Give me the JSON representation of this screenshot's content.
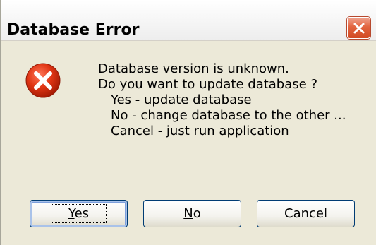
{
  "window": {
    "title": "Database Error",
    "close_icon": "close-icon"
  },
  "dialog": {
    "icon": "error-icon",
    "message_lines": [
      "Database  version is unknown.",
      "Do you want to update database ?",
      "Yes - update database",
      "No - change database to the other ...",
      "Cancel  - just run application"
    ]
  },
  "buttons": {
    "yes": {
      "mnemonic": "Y",
      "rest": "es"
    },
    "no": {
      "mnemonic": "N",
      "rest": "o"
    },
    "cancel": {
      "label": "Cancel"
    }
  },
  "colors": {
    "dialog_bg": "#ece9d8",
    "close_button": "#d24a24",
    "error_icon": "#d8290c"
  }
}
